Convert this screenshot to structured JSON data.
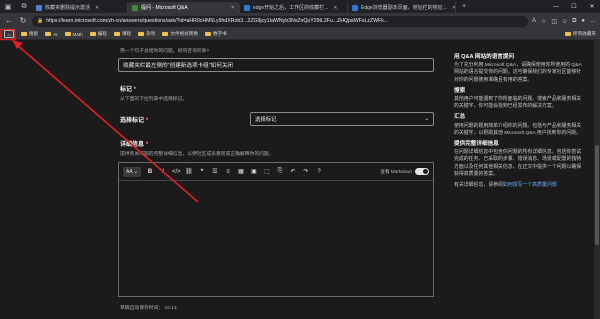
{
  "browser": {
    "tabs": [
      {
        "title": "收藏夹删除提示激活",
        "active": false,
        "color": "#4a7fd0"
      },
      {
        "title": "提问 - Microsoft Q&A",
        "active": true,
        "color": "#3c8c3c"
      },
      {
        "title": "edge开始之后，工作区的收藏栏...",
        "active": false,
        "color": "#2a7ad8"
      },
      {
        "title": "Edge浏览器副本页面，地址栏的地址...",
        "active": false,
        "color": "#2a7ad8"
      }
    ],
    "url": "https://learn.microsoft.com/zh-cn/answers/questions/ask/?id=aHR0cHM6Ly9hdXRob3...2ZG9jcy1taWNyb3NvZnQuY29tL2Fu...ZHQpaWFsLzZWFk...",
    "bookmarks": [
      "搜索",
      "AI",
      "Math",
      "编程",
      "课程",
      "杂项",
      "文件格式转换",
      "数学书"
    ],
    "bookmarks_right": "所有收藏夹"
  },
  "form": {
    "hint_text": "用一个句子总结你的问题。如何咨询问事?",
    "title_value": "收藏夹栏最左侧的“创建新选项卡组”如何关闭",
    "tags_label": "标记",
    "tags_sub": "从下面的下拉列表中选择标记。",
    "select_tag_label": "选择标记",
    "select_tag_value": "选择标记",
    "details_label": "详细信息",
    "details_sub": "提供有关问题的完整详细信息，以便社区成员重现或正确解释你的问题。",
    "markdown_toggle": "查看 Markdown",
    "autosave": "草稿自动保存时间： 15:13"
  },
  "toolbar": {
    "icons": [
      "aa-icon",
      "bold-icon",
      "italic-icon",
      "code-icon",
      "link-icon",
      "quote-icon",
      "bullet-list-icon",
      "numbered-list-icon",
      "table-icon",
      "image-icon",
      "screenshot-icon",
      "attach-icon",
      "undo-icon",
      "redo-icon",
      "help-icon"
    ]
  },
  "sidebar": {
    "sections": [
      {
        "heading": "用 Q&A 网站的语言提问",
        "body": "为了充分利用 Microsoft Q&A，请确保使用你所使用的 Q&A 网站的语言提交你的问题。这可确保我们的专家社区能够针对你的问题使用准确且有用的答案。"
      },
      {
        "heading": "搜索",
        "body": "其他用户可能遇到了你所面临的问题。搜索产品和服务相关的关键字，你可能会找到已经发布的解决方案。"
      },
      {
        "heading": "汇总",
        "body": "使用问题的题用简单介绍你的问题。包括与产品和服务相关的关键字，以帮助其他 Microsoft Q&A 用户找到你的问题。"
      },
      {
        "heading": "提供完整详细信息",
        "body": "在问题详细信息中包含你问题的所有详细信息。包括你尝试完成的任务、已采取的步骤、错误消息、场景或配置的独特方面以及任何其他相关信息。在正文中提供一个问题以确保获得高质量的答案。"
      }
    ],
    "more_text": "有关详细信息，请参阅",
    "more_link": "如何撰写一个高质量问题"
  }
}
